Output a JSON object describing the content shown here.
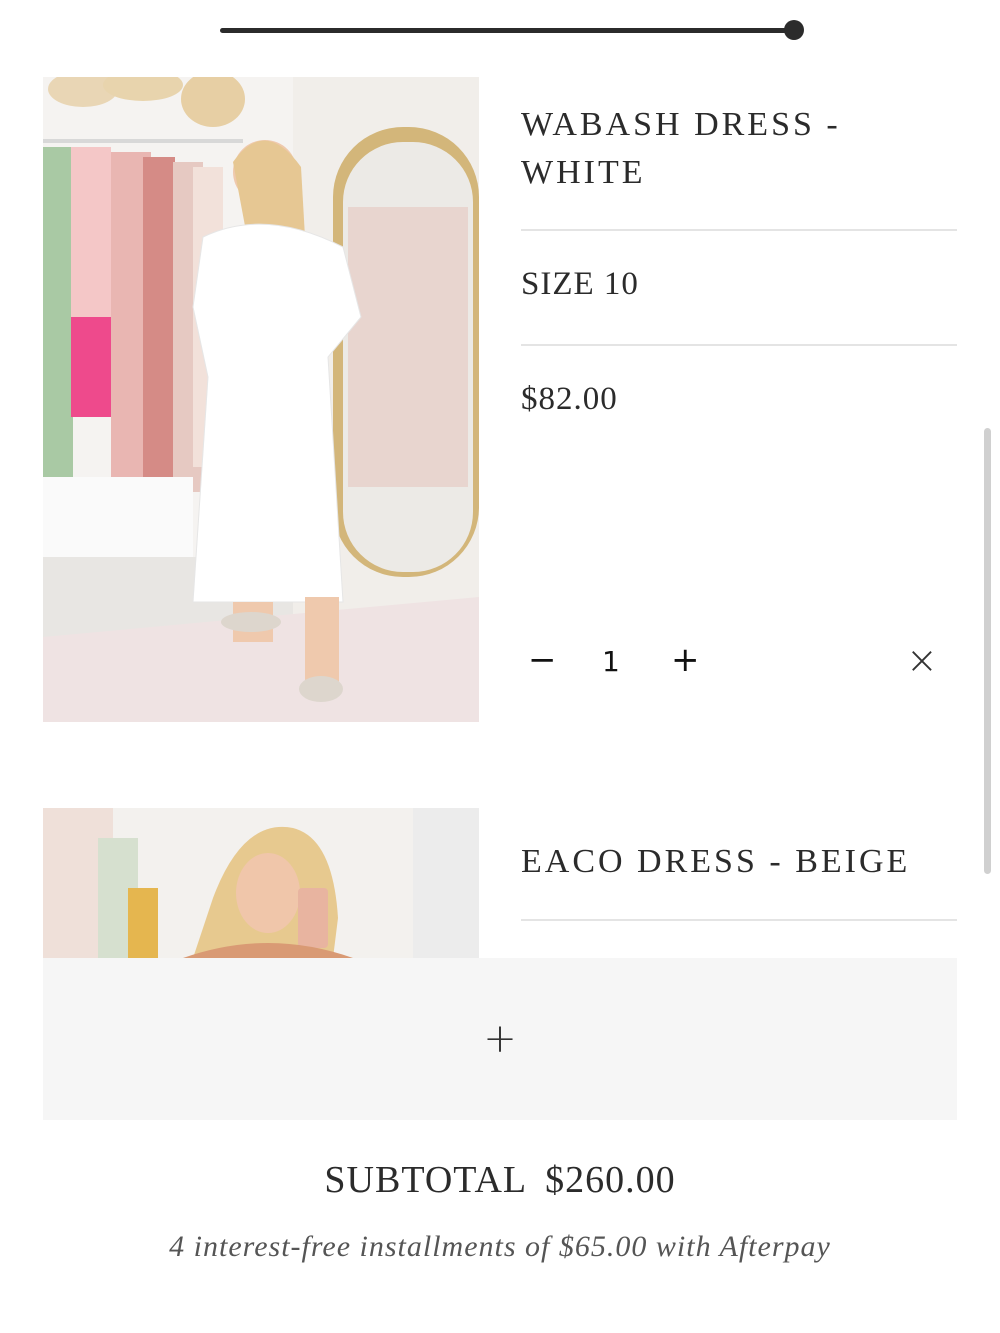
{
  "cart": {
    "items": [
      {
        "name": "WABASH DRESS - WHITE",
        "size": "SIZE 10",
        "price": "$82.00",
        "quantity": "1"
      },
      {
        "name": "EACO DRESS - BEIGE"
      }
    ],
    "controls": {
      "decrement": "−",
      "increment": "+",
      "remove": "×",
      "add": "+"
    }
  },
  "summary": {
    "subtotal_label": "SUBTOTAL",
    "subtotal_value": "$260.00",
    "afterpay_text": "4 interest-free installments of $65.00 with Afterpay"
  },
  "icons": {
    "progress": "slider-knob-icon",
    "remove": "close-icon",
    "add": "plus-icon"
  }
}
